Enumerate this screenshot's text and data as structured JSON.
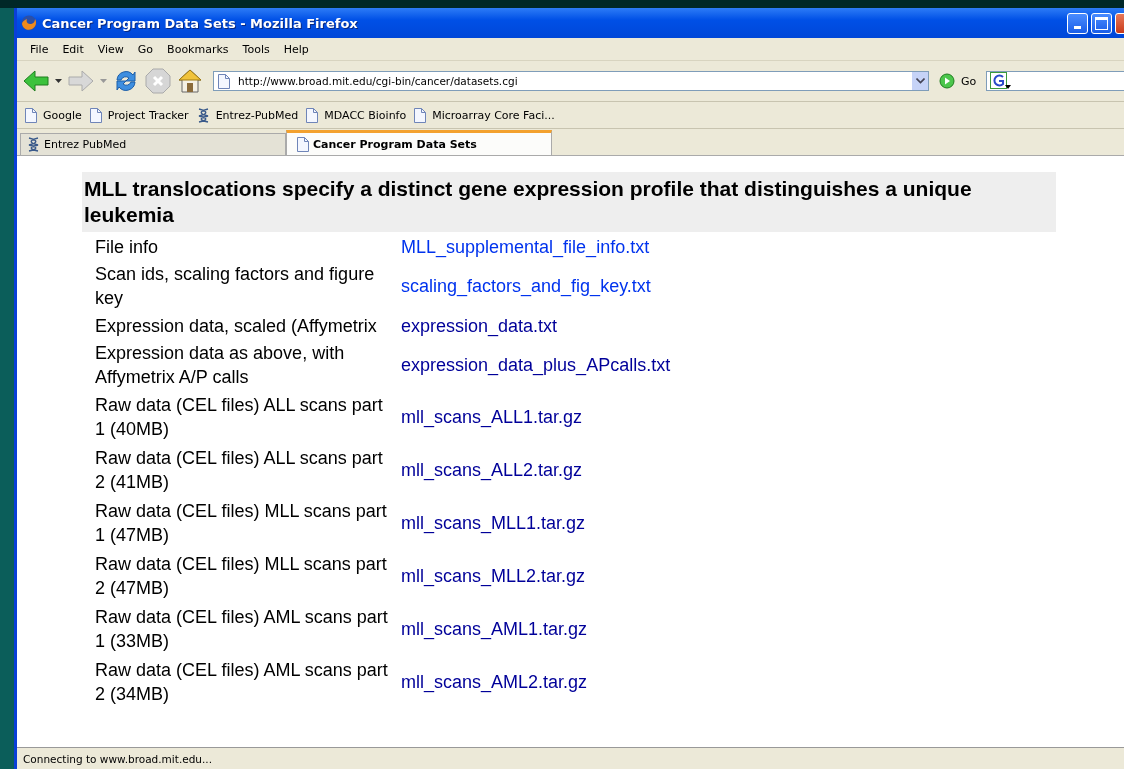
{
  "window": {
    "title": "Cancer Program Data Sets - Mozilla Firefox"
  },
  "menu": [
    "File",
    "Edit",
    "View",
    "Go",
    "Bookmarks",
    "Tools",
    "Help"
  ],
  "address": {
    "url": "http://www.broad.mit.edu/cgi-bin/cancer/datasets.cgi",
    "go": "Go"
  },
  "bookmarks": [
    {
      "label": "Google",
      "kind": "page"
    },
    {
      "label": "Project Tracker",
      "kind": "page"
    },
    {
      "label": "Entrez-PubMed",
      "kind": "helix"
    },
    {
      "label": "MDACC Bioinfo",
      "kind": "page"
    },
    {
      "label": "Microarray Core Faci...",
      "kind": "page"
    }
  ],
  "tabs": [
    {
      "label": "Entrez PubMed",
      "kind": "helix",
      "selected": false
    },
    {
      "label": "Cancer Program Data Sets",
      "kind": "page",
      "selected": true
    }
  ],
  "page": {
    "heading": "MLL translocations specify a distinct gene expression profile that distinguishes a unique leukemia",
    "rows": [
      {
        "label": "File info",
        "link": "MLL_supplemental_file_info.txt",
        "visited": false
      },
      {
        "label": "Scan ids, scaling factors and figure key",
        "link": "scaling_factors_and_fig_key.txt",
        "visited": false
      },
      {
        "label": "Expression data, scaled (Affymetrix",
        "link": "expression_data.txt",
        "visited": true
      },
      {
        "label": "Expression data as above, with Affymetrix A/P calls",
        "link": "expression_data_plus_APcalls.txt",
        "visited": true
      },
      {
        "label": "Raw data (CEL files) ALL scans part 1 (40MB)",
        "link": "mll_scans_ALL1.tar.gz",
        "visited": true
      },
      {
        "label": "Raw data (CEL files) ALL scans part 2 (41MB)",
        "link": "mll_scans_ALL2.tar.gz",
        "visited": true
      },
      {
        "label": "Raw data (CEL files) MLL scans part 1 (47MB)",
        "link": "mll_scans_MLL1.tar.gz",
        "visited": true
      },
      {
        "label": "Raw data (CEL files) MLL scans part 2 (47MB)",
        "link": "mll_scans_MLL2.tar.gz",
        "visited": true
      },
      {
        "label": "Raw data (CEL files) AML scans part 1 (33MB)",
        "link": "mll_scans_AML1.tar.gz",
        "visited": true
      },
      {
        "label": "Raw data (CEL files) AML scans part 2 (34MB)",
        "link": "mll_scans_AML2.tar.gz",
        "visited": true
      }
    ]
  },
  "status_bar": "Connecting to www.broad.mit.edu..."
}
